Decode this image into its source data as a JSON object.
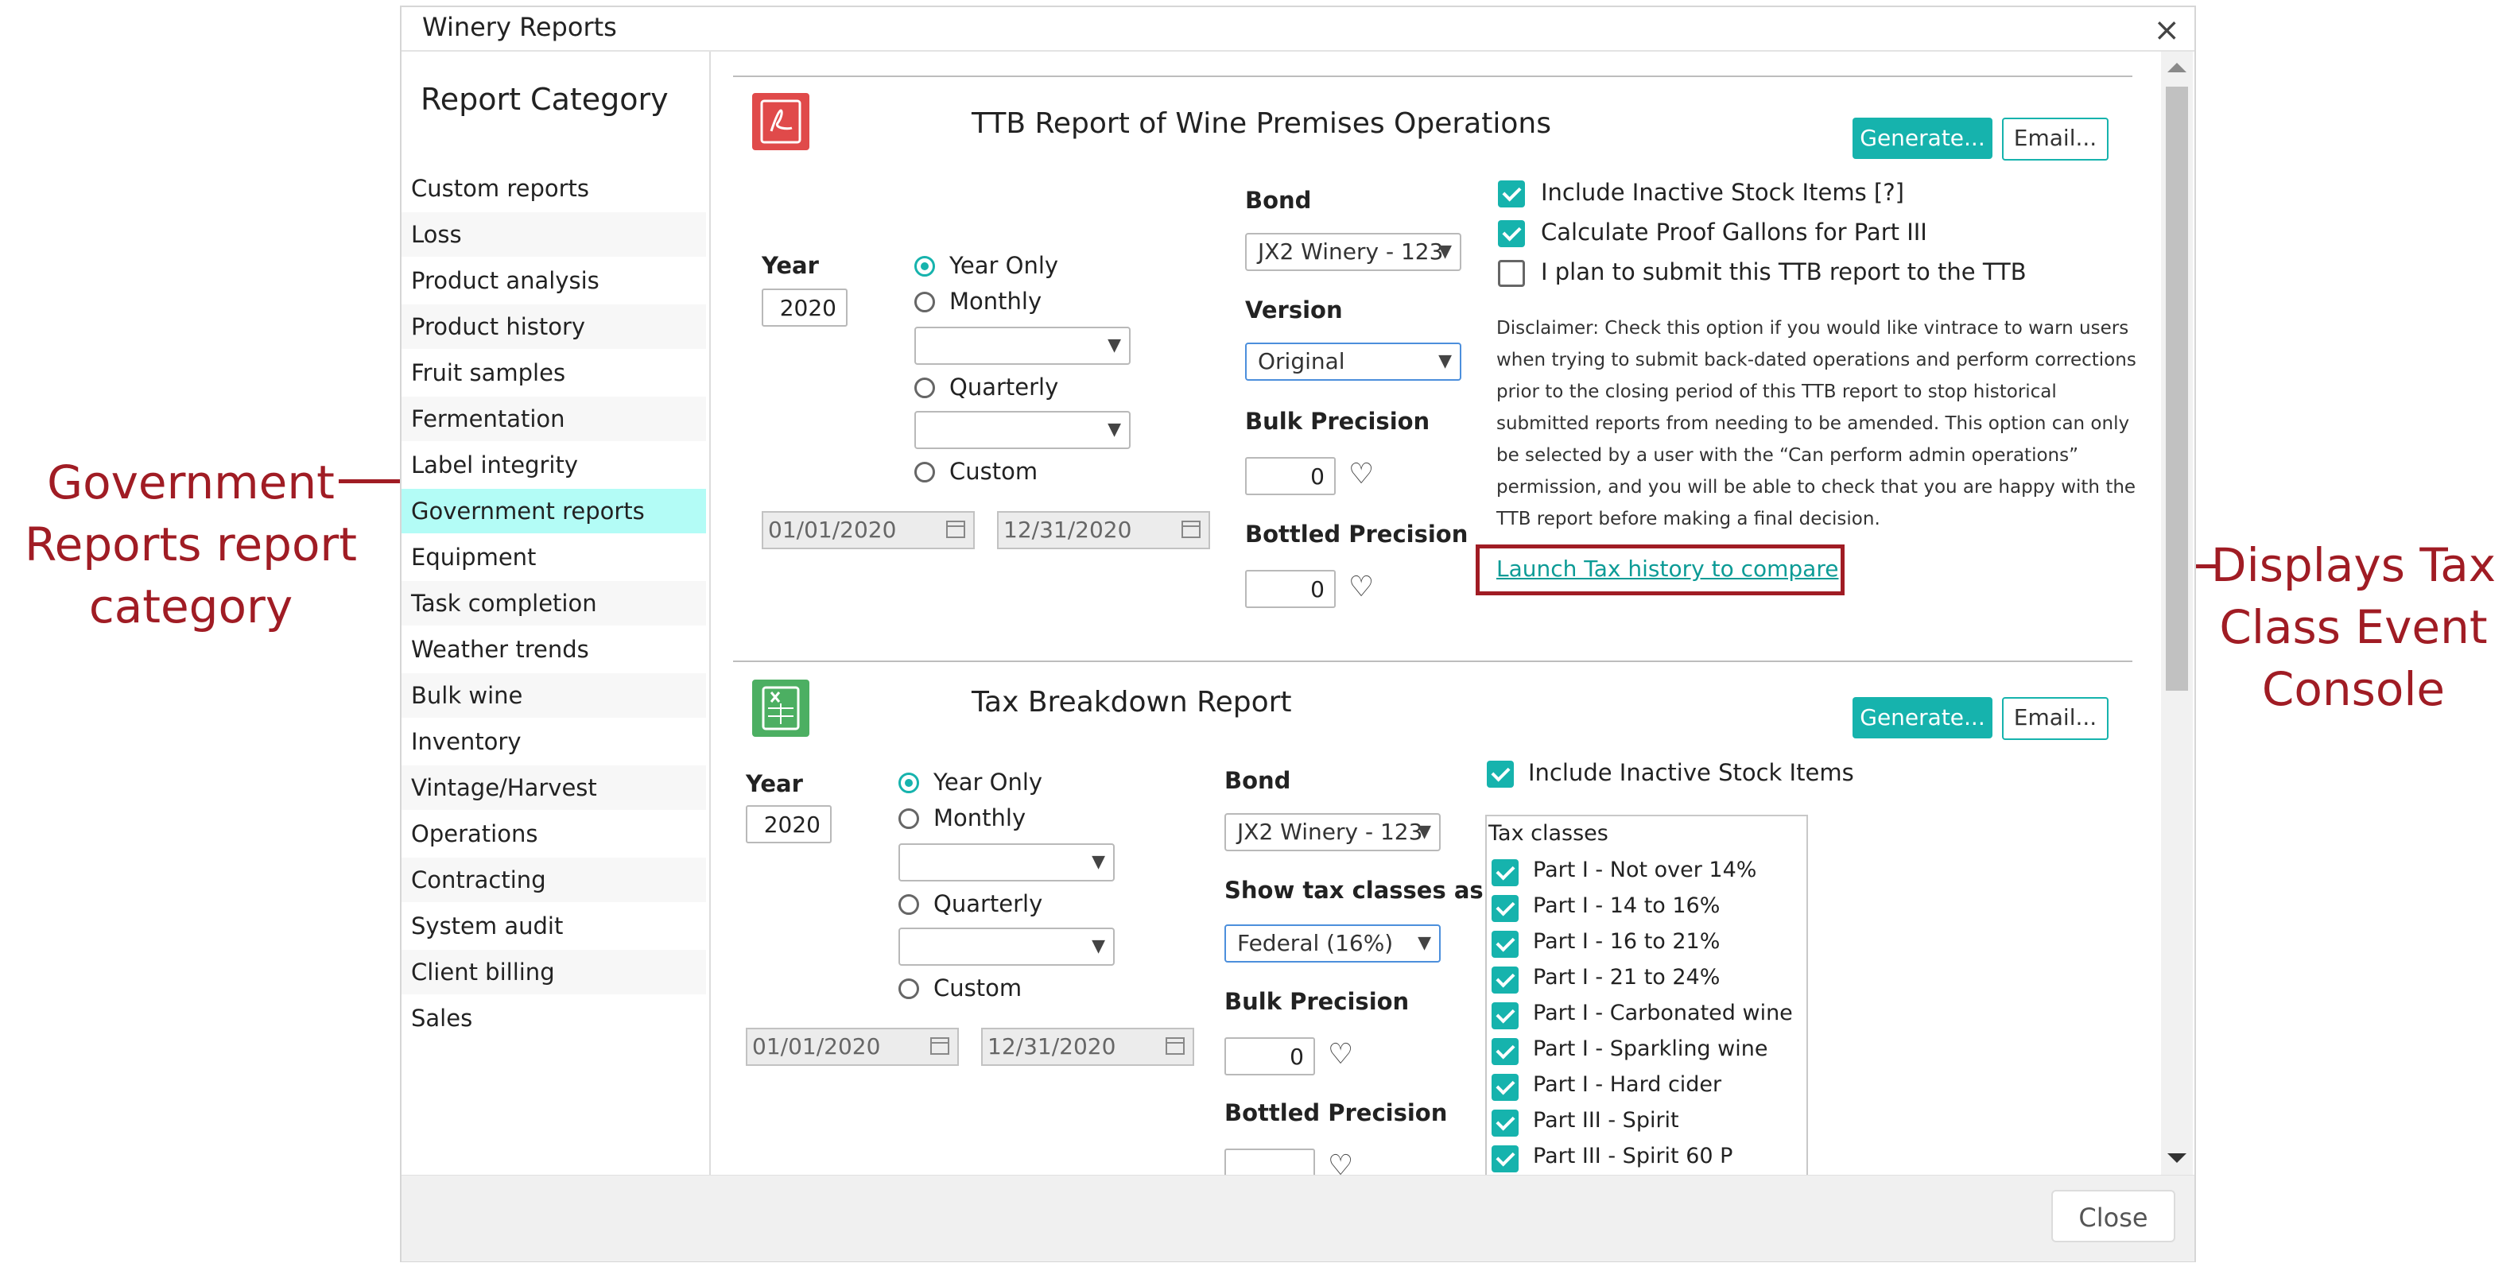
{
  "annotations": {
    "left_callout": [
      "Government",
      "Reports report",
      "category"
    ],
    "right_callout": [
      "Displays Tax",
      "Class Event",
      "Console"
    ]
  },
  "dialog": {
    "title": "Winery Reports",
    "close_glyph": "×",
    "footer_close_label": "Close"
  },
  "sidebar": {
    "header": "Report Category",
    "active_item": "Government reports",
    "items": [
      "Custom reports",
      "Loss",
      "Product analysis",
      "Product history",
      "Fruit samples",
      "Fermentation",
      "Label integrity",
      "Government reports",
      "Equipment",
      "Task completion",
      "Weather trends",
      "Bulk wine",
      "Inventory",
      "Vintage/Harvest",
      "Operations",
      "Contracting",
      "System audit",
      "Client billing",
      "Sales"
    ]
  },
  "ttb_report": {
    "title": "TTB Report of Wine Premises Operations",
    "generate_label": "Generate...",
    "email_label": "Email...",
    "year_label": "Year",
    "year_value": "2020",
    "period_options": [
      "Year Only",
      "Monthly",
      "Quarterly",
      "Custom"
    ],
    "selected_period": "Year Only",
    "start_date": "01/01/2020",
    "end_date": "12/31/2020",
    "bond_label": "Bond",
    "bond_value": "JX2 Winery - 123",
    "version_label": "Version",
    "version_value": "Original",
    "bulk_precision_label": "Bulk Precision",
    "bulk_precision_value": "0",
    "bottled_precision_label": "Bottled Precision",
    "bottled_precision_value": "0",
    "options": [
      {
        "label": "Include Inactive Stock Items [?]",
        "checked": true
      },
      {
        "label": "Calculate Proof Gallons for Part III",
        "checked": true
      },
      {
        "label": "I plan to submit this TTB report to the TTB",
        "checked": false
      }
    ],
    "disclaimer_lines": [
      "Disclaimer: Check this option if you would like vintrace to warn users",
      "when trying to submit back-dated operations and perform corrections",
      "prior to the closing period of this TTB report to stop historical",
      "submitted reports from needing to be amended. This option can only",
      "be selected by a user with the “Can perform admin operations”",
      "permission, and you will be able to check that you are happy with the",
      "TTB report before making a final decision."
    ],
    "compare_link": "Launch Tax history to compare"
  },
  "tax_report": {
    "title": "Tax Breakdown Report",
    "generate_label": "Generate...",
    "email_label": "Email...",
    "year_label": "Year",
    "year_value": "2020",
    "period_options": [
      "Year Only",
      "Monthly",
      "Quarterly",
      "Custom"
    ],
    "selected_period": "Year Only",
    "start_date": "01/01/2020",
    "end_date": "12/31/2020",
    "bond_label": "Bond",
    "bond_value": "JX2 Winery - 123",
    "show_tax_label": "Show tax classes as...",
    "show_tax_value": "Federal (16%)",
    "bulk_precision_label": "Bulk Precision",
    "bulk_precision_value": "0",
    "bottled_precision_label": "Bottled Precision",
    "include_inactive_label": "Include Inactive Stock Items",
    "tax_classes_header": "Tax classes",
    "tax_classes": [
      "Part I - Not over 14%",
      "Part I - 14 to 16%",
      "Part I - 16 to 21%",
      "Part I - 21 to 24%",
      "Part I - Carbonated wine",
      "Part I - Sparkling wine",
      "Part I - Hard cider",
      "Part III - Spirit",
      "Part III - Spirit 60 P"
    ]
  },
  "colors": {
    "accent": "#16b3ad",
    "active_row": "#b3fcf6",
    "annotation": "#a01c24",
    "pdf_icon": "#e04a4a",
    "xls_icon": "#4caf62"
  }
}
